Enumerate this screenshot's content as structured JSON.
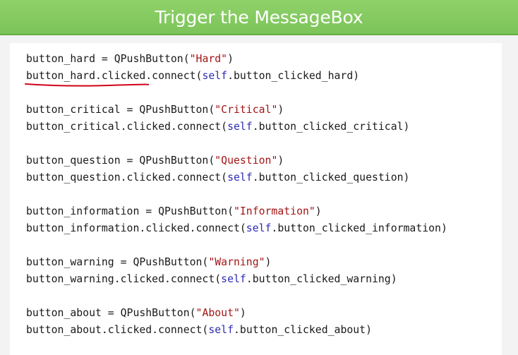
{
  "slide": {
    "title": "Trigger the MessageBox"
  },
  "code": {
    "lines": [
      {
        "pre": "button_hard = QPushButton(",
        "str": "\"Hard\"",
        "post": ")"
      },
      {
        "pre": "button_hard.clicked.connect(",
        "kw": "self",
        "post": ".button_clicked_hard)"
      },
      {
        "pre": "button_critical = QPushButton(",
        "str": "\"Critical\"",
        "post": ")"
      },
      {
        "pre": "button_critical.clicked.connect(",
        "kw": "self",
        "post": ".button_clicked_critical)"
      },
      {
        "pre": "button_question = QPushButton(",
        "str": "\"Question\"",
        "post": ")"
      },
      {
        "pre": "button_question.clicked.connect(",
        "kw": "self",
        "post": ".button_clicked_question)"
      },
      {
        "pre": "button_information = QPushButton(",
        "str": "\"Information\"",
        "post": ")"
      },
      {
        "pre": "button_information.clicked.connect(",
        "kw": "self",
        "post": ".button_clicked_information)"
      },
      {
        "pre": "button_warning = QPushButton(",
        "str": "\"Warning\"",
        "post": ")"
      },
      {
        "pre": "button_warning.clicked.connect(",
        "kw": "self",
        "post": ".button_clicked_warning)"
      },
      {
        "pre": "button_about = QPushButton(",
        "str": "\"About\"",
        "post": ")"
      },
      {
        "pre": "button_about.clicked.connect(",
        "kw": "self",
        "post": ".button_clicked_about)"
      }
    ]
  },
  "colors": {
    "header": "#7cc45a",
    "string": "#a31515",
    "keyword": "#2b2bb3",
    "annotation": "#d0021b"
  }
}
